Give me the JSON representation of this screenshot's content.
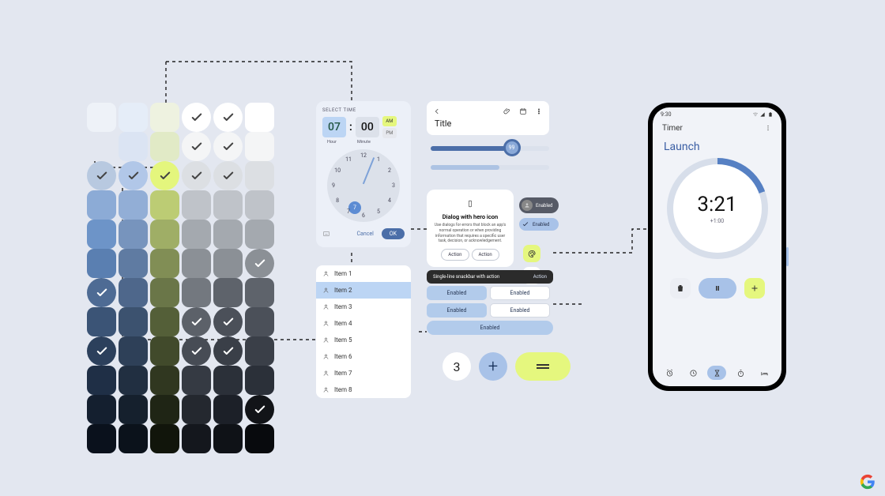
{
  "timepicker": {
    "label": "SELECT TIME",
    "hour": "07",
    "minute": "00",
    "am": "AM",
    "pm": "PM",
    "hour_label": "Hour",
    "minute_label": "Minute",
    "clock": {
      "numbers": [
        "12",
        "1",
        "2",
        "3",
        "4",
        "5",
        "6",
        "7",
        "8",
        "9",
        "10",
        "11"
      ],
      "selected": "7"
    },
    "cancel": "Cancel",
    "ok": "OK"
  },
  "list": {
    "items": [
      "Item 1",
      "Item 2",
      "Item 3",
      "Item 4",
      "Item 5",
      "Item 6",
      "Item 7",
      "Item 8"
    ],
    "selected_index": 1
  },
  "titlecard": {
    "title": "Title"
  },
  "slider": {
    "value_label": "99"
  },
  "dialog": {
    "title": "Dialog with hero icon",
    "body": "Use dialogs for errors that block an app's normal operation or when providing information that requires a specific user task, decision, or acknowledgement.",
    "action1": "Action",
    "action2": "Action"
  },
  "chips": {
    "a": "Enabled",
    "b": "Enabled"
  },
  "snackbar": {
    "text": "Single-line snackbar with action",
    "action": "Action"
  },
  "buttons": {
    "a": "Enabled",
    "b": "Enabled",
    "c": "Enabled",
    "d": "Enabled",
    "wide": "Enabled"
  },
  "bottom": {
    "num": "3",
    "plus": "+",
    "equals": "—"
  },
  "phone": {
    "status_time": "9:30",
    "app_title": "Timer",
    "label": "Launch",
    "time": "3:21",
    "increment": "+1:00"
  },
  "palette": {
    "colors": [
      [
        "#eef2f8",
        "#e5edf8",
        "#eef2e0",
        "#ffffff",
        "#ffffff",
        "#ffffff"
      ],
      [
        "#e3e7f0",
        "#dbe4f3",
        "#e1eac6",
        "#f4f5f6",
        "#f4f5f6",
        "#f4f5f6"
      ],
      [
        "#b8c9e0",
        "#b1c7e8",
        "#e4f67d",
        "#dcdfe3",
        "#dcdfe3",
        "#dcdfe3"
      ],
      [
        "#8cabd6",
        "#92aed6",
        "#bccc74",
        "#bfc3c9",
        "#bfc3c9",
        "#bfc3c9"
      ],
      [
        "#6d94c8",
        "#7794bd",
        "#9fae66",
        "#a4a9af",
        "#a4a9af",
        "#a4a9af"
      ],
      [
        "#5a7fb1",
        "#5f7ba2",
        "#818e55",
        "#8b9096",
        "#8b9096",
        "#8b9096"
      ],
      [
        "#4e6b94",
        "#4e678b",
        "#6a7648",
        "#73787f",
        "#5e636b",
        "#5e636b"
      ],
      [
        "#3b5476",
        "#3c526f",
        "#545f38",
        "#5c6169",
        "#4b5059",
        "#4b5059"
      ],
      [
        "#2c405c",
        "#2e4058",
        "#414a2b",
        "#474c55",
        "#3a3f48",
        "#3a3f48"
      ],
      [
        "#1f2f46",
        "#212f41",
        "#303720",
        "#353a43",
        "#2b3039",
        "#2b3039"
      ],
      [
        "#141f2f",
        "#15202d",
        "#1f2515",
        "#24282f",
        "#1c2028",
        "#121418"
      ],
      [
        "#0a111c",
        "#0b121b",
        "#11150b",
        "#14171d",
        "#0f1217",
        "#080a0d"
      ]
    ],
    "checks_light": [
      [
        0,
        3
      ],
      [
        0,
        4
      ],
      [
        1,
        3
      ],
      [
        1,
        4
      ],
      [
        2,
        0
      ],
      [
        2,
        1
      ],
      [
        2,
        2
      ],
      [
        2,
        3
      ],
      [
        2,
        4
      ]
    ],
    "checks_dark": [
      [
        5,
        5
      ],
      [
        6,
        0
      ],
      [
        7,
        3
      ],
      [
        7,
        4
      ],
      [
        8,
        0
      ],
      [
        8,
        3
      ],
      [
        8,
        4
      ],
      [
        10,
        5
      ]
    ]
  }
}
